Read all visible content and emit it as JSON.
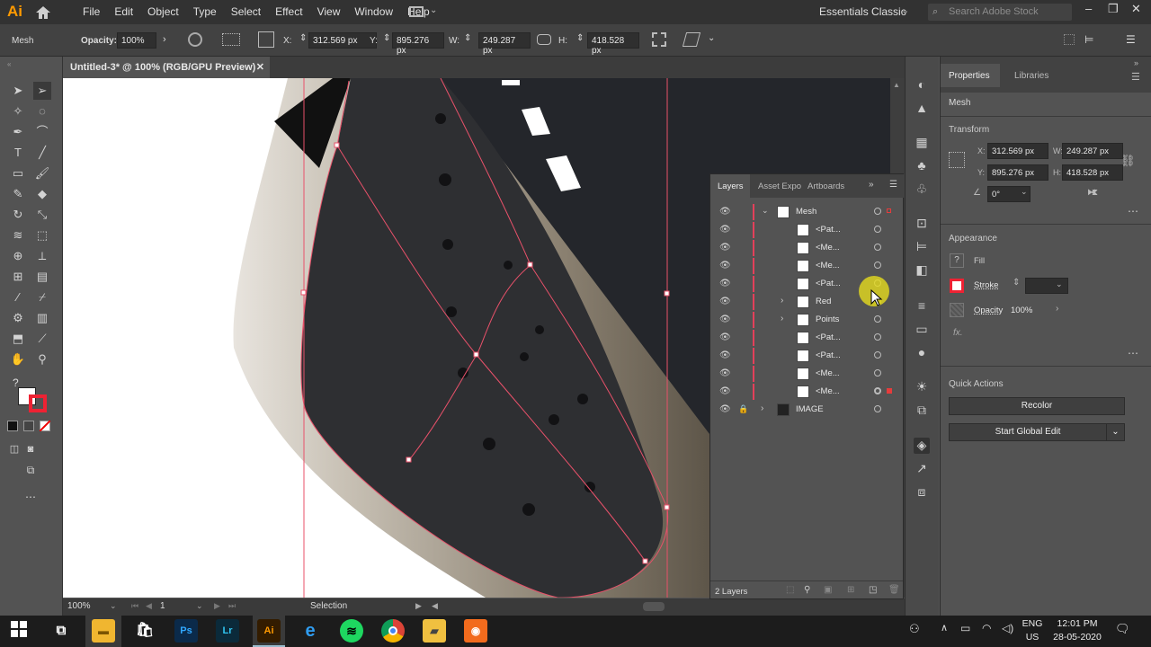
{
  "app": {
    "logo": "Ai",
    "menu": [
      "File",
      "Edit",
      "Object",
      "Type",
      "Select",
      "Effect",
      "View",
      "Window",
      "Help"
    ],
    "workspace": "Essentials Classic",
    "search_placeholder": "Search Adobe Stock"
  },
  "control": {
    "selection_label": "Mesh",
    "opacity_label": "Opacity:",
    "opacity_value": "100%",
    "x_label": "X:",
    "x_value": "312.569 px",
    "y_label": "Y:",
    "y_value": "895.276 px",
    "w_label": "W:",
    "w_value": "249.287 px",
    "h_label": "H:",
    "h_value": "418.528 px"
  },
  "document": {
    "tab_title": "Untitled-3* @ 100% (RGB/GPU Preview)"
  },
  "status": {
    "zoom": "100%",
    "artboard": "1",
    "tool": "Selection"
  },
  "layers_panel": {
    "tabs": [
      "Layers",
      "Asset Expo",
      "Artboards"
    ],
    "rows": [
      {
        "name": "Mesh",
        "indent": 0,
        "expanded": true
      },
      {
        "name": "<Pat...",
        "indent": 1
      },
      {
        "name": "<Me...",
        "indent": 1
      },
      {
        "name": "<Me...",
        "indent": 1
      },
      {
        "name": "<Pat...",
        "indent": 1
      },
      {
        "name": "Red",
        "indent": 1,
        "group": true
      },
      {
        "name": "Points",
        "indent": 1,
        "group": true
      },
      {
        "name": "<Pat...",
        "indent": 1
      },
      {
        "name": "<Pat...",
        "indent": 1
      },
      {
        "name": "<Me...",
        "indent": 1
      },
      {
        "name": "<Me...",
        "indent": 1
      },
      {
        "name": "IMAGE",
        "indent": 0,
        "locked": true
      }
    ],
    "footer": "2 Layers"
  },
  "properties_panel": {
    "tabs": [
      "Properties",
      "Libraries"
    ],
    "selection": "Mesh",
    "transform_title": "Transform",
    "x_label": "X:",
    "x_value": "312.569 px",
    "y_label": "Y:",
    "y_value": "895.276 px",
    "w_label": "W:",
    "w_value": "249.287 px",
    "h_label": "H:",
    "h_value": "418.528 px",
    "angle_value": "0°",
    "appearance_title": "Appearance",
    "fill_label": "Fill",
    "stroke_label": "Stroke",
    "opacity_label": "Opacity",
    "opacity_value": "100%",
    "fx_label": "fx.",
    "quick_actions_title": "Quick Actions",
    "recolor_btn": "Recolor",
    "global_edit_btn": "Start Global Edit"
  },
  "taskbar": {
    "lang_top": "ENG",
    "lang_bottom": "US",
    "time": "12:01 PM",
    "date": "28-05-2020"
  }
}
